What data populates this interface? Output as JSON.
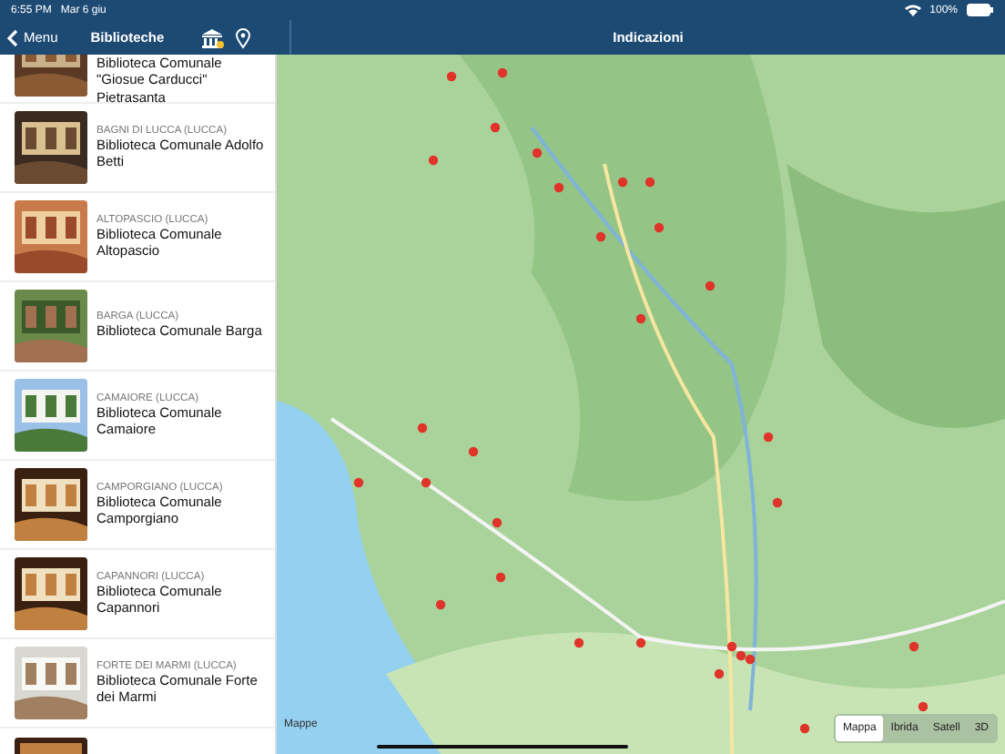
{
  "status_bar": {
    "time": "6:55 PM",
    "date": "Mar 6 giu",
    "battery": "100%"
  },
  "sidebar": {
    "back": "Menu",
    "title": "Biblioteche",
    "items": [
      {
        "name": "Biblioteca Comunale \"Giosue Carducci\" Pietrasanta"
      },
      {
        "place": "BAGNI DI LUCCA (LUCCA)",
        "name": "Biblioteca Comunale Adolfo Betti"
      },
      {
        "place": "ALTOPASCIO (LUCCA)",
        "name": "Biblioteca Comunale Altopascio"
      },
      {
        "place": "BARGA (LUCCA)",
        "name": "Biblioteca Comunale Barga"
      },
      {
        "place": "CAMAIORE (LUCCA)",
        "name": "Biblioteca Comunale Camaiore"
      },
      {
        "place": "CAMPORGIANO (LUCCA)",
        "name": "Biblioteca Comunale Camporgiano"
      },
      {
        "place": "CAPANNORI (LUCCA)",
        "name": "Biblioteca Comunale Capannori"
      },
      {
        "place": "FORTE DEI MARMI (LUCCA)",
        "name": "Biblioteca Comunale Forte dei Marmi"
      }
    ]
  },
  "detail": {
    "title": "Indicazioni",
    "map": {
      "kind": "picture",
      "attribution": "Mappe",
      "map_types": [
        {
          "label": "Mappa",
          "selected": true
        },
        {
          "label": "Ibrida",
          "selected": false
        },
        {
          "label": "Satell",
          "selected": false
        },
        {
          "label": "3D",
          "selected": false
        }
      ]
    }
  }
}
